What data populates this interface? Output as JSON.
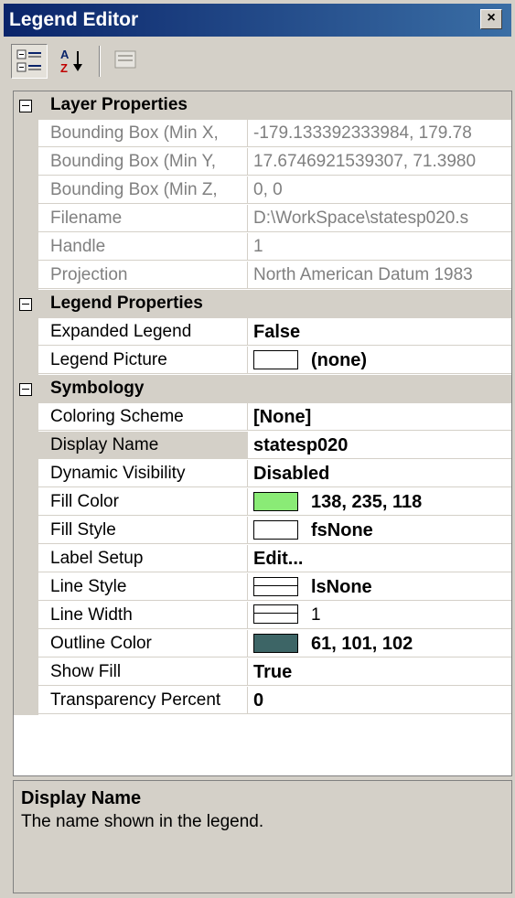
{
  "window": {
    "title": "Legend Editor",
    "close_glyph": "×"
  },
  "toolbar": {
    "buttons": [
      {
        "name": "categorized-view",
        "icon": "categorized-icon",
        "pressed": true
      },
      {
        "name": "alphabetical-sort",
        "icon": "sort-az-icon",
        "pressed": false
      },
      {
        "name": "property-pages",
        "icon": "property-pages-icon",
        "disabled": true
      }
    ]
  },
  "grid": {
    "categories": [
      {
        "label": "Layer Properties",
        "rows": [
          {
            "name": "Bounding Box (Min X,",
            "value": "-179.133392333984, 179.78",
            "readonly": true
          },
          {
            "name": "Bounding Box (Min Y,",
            "value": "17.6746921539307, 71.3980",
            "readonly": true
          },
          {
            "name": "Bounding Box (Min Z,",
            "value": "0, 0",
            "readonly": true
          },
          {
            "name": "Filename",
            "value": "D:\\WorkSpace\\statesp020.s",
            "readonly": true
          },
          {
            "name": "Handle",
            "value": "1",
            "readonly": true
          },
          {
            "name": "Projection",
            "value": "North American Datum 1983",
            "readonly": true
          }
        ]
      },
      {
        "label": "Legend Properties",
        "rows": [
          {
            "name": "Expanded Legend",
            "value": "False",
            "bold": true
          },
          {
            "name": "Legend Picture",
            "value": "(none)",
            "bold": true,
            "swatch": "#ffffff"
          }
        ]
      },
      {
        "label": "Symbology",
        "rows": [
          {
            "name": "Coloring Scheme",
            "value": "[None]",
            "bold": true
          },
          {
            "name": "Display Name",
            "value": "statesp020",
            "bold": true,
            "selected": true
          },
          {
            "name": "Dynamic Visibility",
            "value": "Disabled",
            "bold": true
          },
          {
            "name": "Fill Color",
            "value": "138, 235, 118",
            "bold": true,
            "swatch": "#8aeb76"
          },
          {
            "name": "Fill Style",
            "value": "fsNone",
            "bold": true,
            "swatch": "#ffffff"
          },
          {
            "name": "Label Setup",
            "value": "Edit...",
            "bold": true
          },
          {
            "name": "Line Style",
            "value": "lsNone",
            "bold": true,
            "swatch": "line"
          },
          {
            "name": "Line Width",
            "value": "1",
            "bold": false,
            "swatch": "line"
          },
          {
            "name": "Outline Color",
            "value": "61, 101, 102",
            "bold": true,
            "swatch": "#3d6566"
          },
          {
            "name": "Show Fill",
            "value": "True",
            "bold": true
          },
          {
            "name": "Transparency Percent",
            "value": "0",
            "bold": true
          }
        ]
      }
    ]
  },
  "description": {
    "title": "Display Name",
    "text": "The name shown in the legend."
  }
}
